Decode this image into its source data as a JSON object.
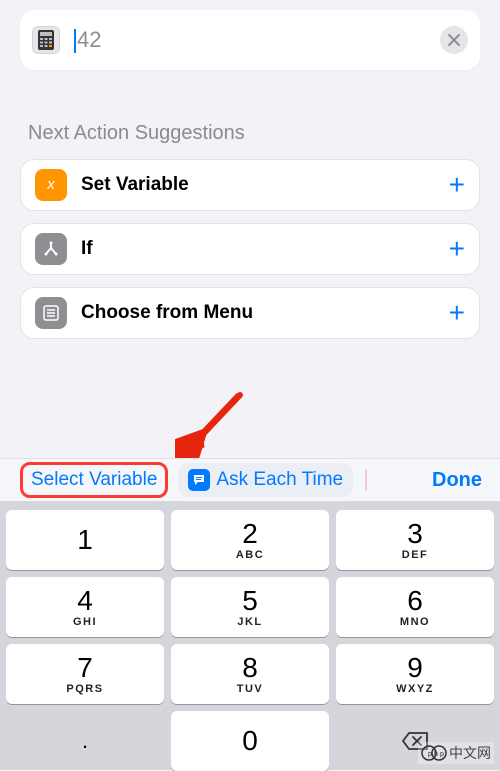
{
  "input": {
    "value": "42"
  },
  "suggestions": {
    "title": "Next Action Suggestions",
    "items": [
      {
        "label": "Set Variable",
        "icon": "variable",
        "color": "orange"
      },
      {
        "label": "If",
        "icon": "branch",
        "color": "grey"
      },
      {
        "label": "Choose from Menu",
        "icon": "menu",
        "color": "grey"
      }
    ]
  },
  "accessory": {
    "select_variable": "Select Variable",
    "ask_each_time": "Ask Each Time",
    "done": "Done"
  },
  "keypad": [
    {
      "num": "1",
      "sub": ""
    },
    {
      "num": "2",
      "sub": "ABC"
    },
    {
      "num": "3",
      "sub": "DEF"
    },
    {
      "num": "4",
      "sub": "GHI"
    },
    {
      "num": "5",
      "sub": "JKL"
    },
    {
      "num": "6",
      "sub": "MNO"
    },
    {
      "num": "7",
      "sub": "PQRS"
    },
    {
      "num": "8",
      "sub": "TUV"
    },
    {
      "num": "9",
      "sub": "WXYZ"
    },
    {
      "num": ".",
      "sub": "",
      "flat": true
    },
    {
      "num": "0",
      "sub": ""
    },
    {
      "num": "",
      "sub": "",
      "flat": true,
      "icon": "delete"
    }
  ],
  "watermark": "中文网"
}
